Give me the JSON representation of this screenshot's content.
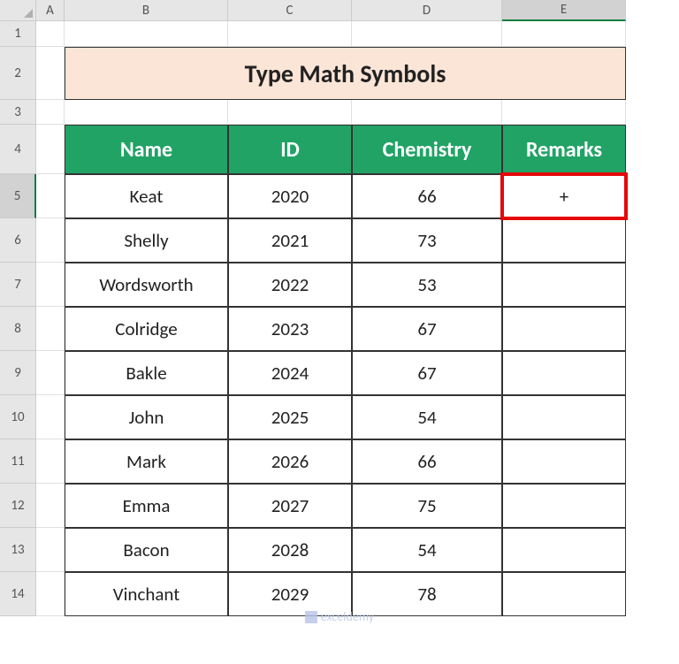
{
  "columns": [
    {
      "letter": "A",
      "width": 32
    },
    {
      "letter": "B",
      "width": 185
    },
    {
      "letter": "C",
      "width": 140
    },
    {
      "letter": "D",
      "width": 170
    },
    {
      "letter": "E",
      "width": 140
    }
  ],
  "rows": [
    {
      "num": 1,
      "height": 29
    },
    {
      "num": 2,
      "height": 60
    },
    {
      "num": 3,
      "height": 28
    },
    {
      "num": 4,
      "height": 56
    },
    {
      "num": 5,
      "height": 50
    },
    {
      "num": 6,
      "height": 50
    },
    {
      "num": 7,
      "height": 50
    },
    {
      "num": 8,
      "height": 50
    },
    {
      "num": 9,
      "height": 50
    },
    {
      "num": 10,
      "height": 50
    },
    {
      "num": 11,
      "height": 50
    },
    {
      "num": 12,
      "height": 50
    },
    {
      "num": 13,
      "height": 50
    },
    {
      "num": 14,
      "height": 50
    }
  ],
  "title": "Type Math Symbols",
  "headers": {
    "name": "Name",
    "id": "ID",
    "chemistry": "Chemistry",
    "remarks": "Remarks"
  },
  "data": [
    {
      "name": "Keat",
      "id": "2020",
      "chemistry": "66",
      "remarks": "+"
    },
    {
      "name": "Shelly",
      "id": "2021",
      "chemistry": "73",
      "remarks": ""
    },
    {
      "name": "Wordsworth",
      "id": "2022",
      "chemistry": "53",
      "remarks": ""
    },
    {
      "name": "Colridge",
      "id": "2023",
      "chemistry": "67",
      "remarks": ""
    },
    {
      "name": "Bakle",
      "id": "2024",
      "chemistry": "67",
      "remarks": ""
    },
    {
      "name": "John",
      "id": "2025",
      "chemistry": "54",
      "remarks": ""
    },
    {
      "name": "Mark",
      "id": "2026",
      "chemistry": "66",
      "remarks": ""
    },
    {
      "name": "Emma",
      "id": "2027",
      "chemistry": "75",
      "remarks": ""
    },
    {
      "name": "Bacon",
      "id": "2028",
      "chemistry": "54",
      "remarks": ""
    },
    {
      "name": "Vinchant",
      "id": "2029",
      "chemistry": "78",
      "remarks": ""
    }
  ],
  "selected": {
    "row": 5,
    "col": "E"
  },
  "watermark": "exceldemy"
}
